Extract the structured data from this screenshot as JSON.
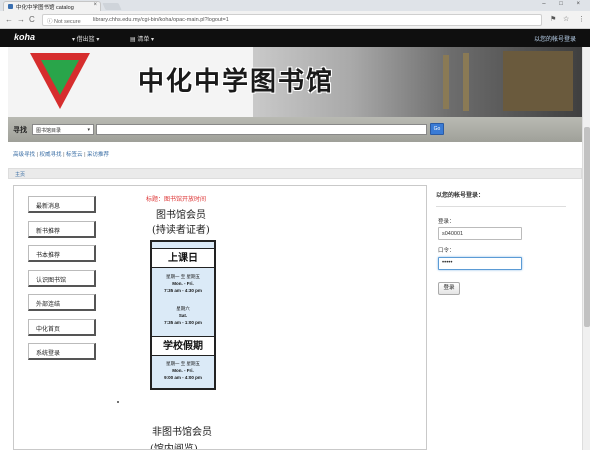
{
  "browser": {
    "tab_title": "中化中学图书馆 catalog",
    "tab_close": "×",
    "window_controls": "–  □  ×",
    "back": "←",
    "forward": "→",
    "reload": "C",
    "secure_label": "ⓘ Not secure",
    "url": "library.chhs.edu.my/cgi-bin/koha/opac-main.pl?logout=1",
    "translate": "⚑",
    "star": "☆",
    "menu": "⋮"
  },
  "navbar": {
    "logo": "koha",
    "cart": "▾ 借出篮 ▾",
    "lists": "▤ 清单 ▾",
    "login_link": "以您的帐号登录"
  },
  "banner": {
    "title": "中化中学图书馆"
  },
  "search": {
    "label": "寻找",
    "scope": "图书馆目录",
    "query": "",
    "go": "Go"
  },
  "quicklinks": {
    "advanced": "高级寻找",
    "authority": "权威寻找",
    "tags": "标签云",
    "recent": "采访推荐"
  },
  "breadcrumb": {
    "home": "主页"
  },
  "menu": {
    "items": [
      {
        "label": "最新消息"
      },
      {
        "label": "新书推荐"
      },
      {
        "label": "书本推荐"
      },
      {
        "label": "认识图书馆"
      },
      {
        "label": "外部连结"
      },
      {
        "label": "中化首页"
      },
      {
        "label": "系统登录"
      }
    ]
  },
  "notice": {
    "red_label": "标题：图书馆开放时间",
    "heading1": "图书馆会员",
    "heading2": "(持读者证者)",
    "card": {
      "class_title": "上课日",
      "weekday_cn": "星期一 至 星期五",
      "weekday_en": "Mon. - Fri.",
      "weekday_time": "7:35 am - 4:30 pm",
      "sat_cn": "星期六",
      "sat_en": "Sat.",
      "sat_time": "7:35 am - 1:00 pm",
      "holiday_title": "学校假期",
      "holiday_cn": "星期一 至 星期五",
      "holiday_en": "Mon. - Fri.",
      "holiday_time": "9:00 am - 4:00 pm"
    },
    "heading3": "非图书馆会员",
    "heading4": "(馆内阅览)"
  },
  "login": {
    "title": "以您的帐号登录：",
    "user_label": "登录：",
    "user_value": "s040001",
    "pass_label": "口令：",
    "pass_value": "•••••",
    "submit": "登录"
  }
}
